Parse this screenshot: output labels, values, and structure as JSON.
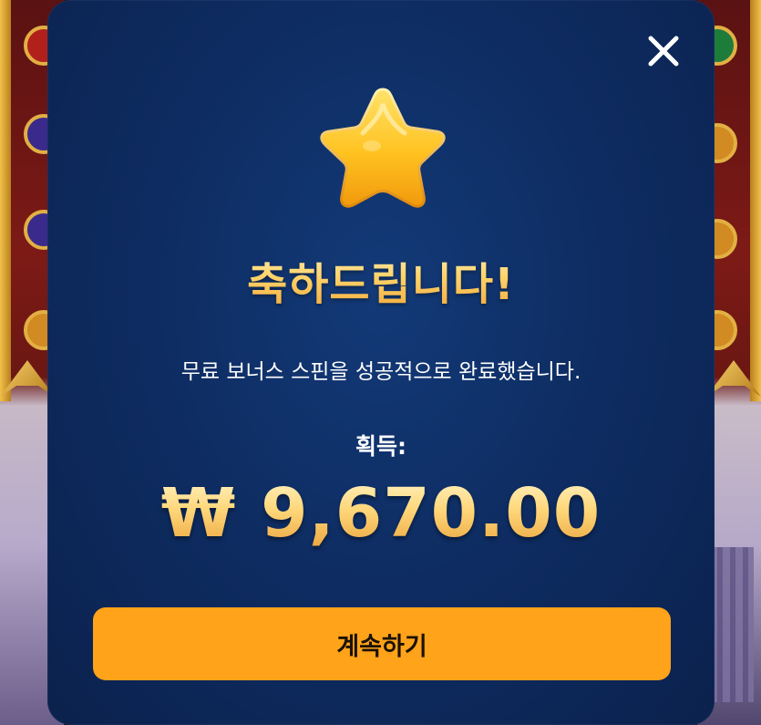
{
  "modal": {
    "title": "축하드립니다!",
    "message": "무료 보너스 스핀을 성공적으로 완료했습니다.",
    "won_label": "획득:",
    "amount": "₩ 9,670.00",
    "continue_label": "계속하기",
    "icons": {
      "close": "close-icon",
      "star": "star-icon"
    }
  },
  "colors": {
    "modal_bg": "#0e2d63",
    "accent_gold": "#ffd77a",
    "button_bg": "#ffa31a",
    "button_text": "#1b1206"
  }
}
